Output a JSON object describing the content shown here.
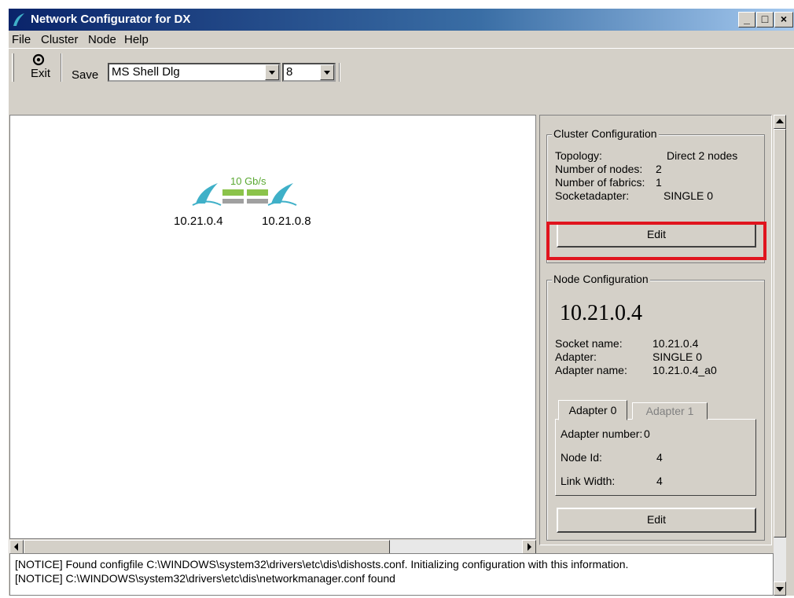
{
  "window": {
    "title": "Network Configurator for DX",
    "controls": {
      "minimize": "_",
      "maximize": "□",
      "close": "×"
    }
  },
  "menu": [
    "File",
    "Cluster",
    "Node",
    "Help"
  ],
  "toolbar": {
    "exit_label": "Exit",
    "save_label": "Save",
    "font_name": "MS Shell Dlg",
    "font_size": "8"
  },
  "topology": {
    "link_speed": "10 Gb/s",
    "nodes": [
      "10.21.0.4",
      "10.21.0.8"
    ]
  },
  "cluster_config": {
    "title": "Cluster Configuration",
    "rows": [
      {
        "label": "Topology:",
        "value": "Direct 2 nodes"
      },
      {
        "label": "Number of nodes:",
        "value": "2"
      },
      {
        "label": "Number of fabrics:",
        "value": "1"
      },
      {
        "label": "Socketadapter:",
        "value": "SINGLE 0"
      }
    ],
    "edit_label": "Edit"
  },
  "node_config": {
    "title": "Node Configuration",
    "ip": "10.21.0.4",
    "rows": [
      {
        "label": "Socket name:",
        "value": "10.21.0.4"
      },
      {
        "label": "Adapter:",
        "value": "SINGLE 0"
      },
      {
        "label": "Adapter name:",
        "value": "10.21.0.4_a0"
      }
    ],
    "tabs": [
      "Adapter 0",
      "Adapter 1"
    ],
    "adapter_rows": [
      {
        "label": "Adapter number:",
        "value": "0"
      },
      {
        "label": "Node Id:",
        "value": "4"
      },
      {
        "label": "Link Width:",
        "value": "4"
      }
    ],
    "edit_label": "Edit"
  },
  "log": [
    "[NOTICE] Found configfile C:\\WINDOWS\\system32\\drivers\\etc\\dis\\dishosts.conf. Initializing configuration with this information.",
    "[NOTICE] C:\\WINDOWS\\system32\\drivers\\etc\\dis\\networkmanager.conf found"
  ],
  "colors": {
    "link": "#9ccc65",
    "node_icon": "#4aa0b8",
    "highlight": "#e0141e"
  }
}
